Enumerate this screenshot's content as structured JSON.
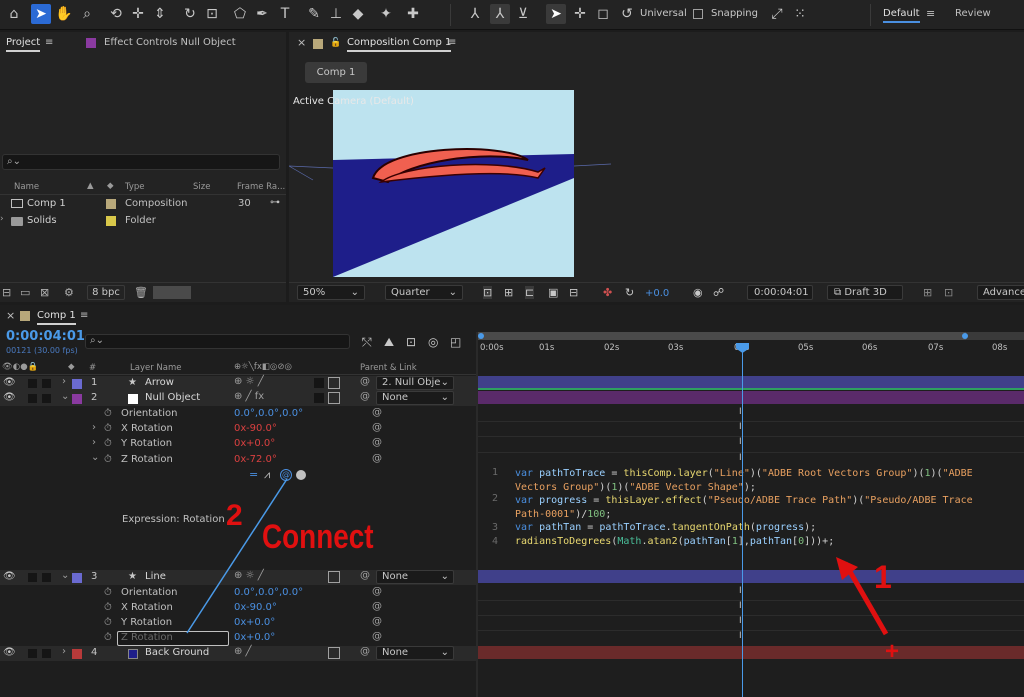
{
  "toolbar": {
    "tools": [
      "home-icon",
      "selection-tool-icon",
      "hand-tool-icon",
      "zoom-tool-icon",
      "orbit-tool-icon",
      "pan-tool-icon",
      "dolly-tool-icon",
      "rotation-tool-icon",
      "pan-behind-tool-icon",
      "shape-tool-icon",
      "pen-tool-icon",
      "type-tool-icon",
      "brush-tool-icon",
      "clone-stamp-icon",
      "eraser-icon",
      "roto-brush-icon",
      "puppet-pin-icon"
    ],
    "universal_label": "Universal",
    "snapping_label": "Snapping",
    "workspace_default": "Default",
    "workspace_review": "Review"
  },
  "project_panel": {
    "tab": "Project",
    "effect_controls_tab": "Effect Controls Null Object",
    "search_placeholder": "",
    "columns": {
      "name": "Name",
      "type": "Type",
      "size": "Size",
      "frame_rate": "Frame Ra..."
    },
    "items": [
      {
        "name": "Comp 1",
        "type": "Composition",
        "size": "",
        "frame_rate": "30",
        "label_color": "#b8a87a"
      },
      {
        "name": "Solids",
        "type": "Folder",
        "size": "",
        "frame_rate": "",
        "label_color": "#d8c84a"
      }
    ],
    "bpc": "8 bpc"
  },
  "composition_panel": {
    "tab": "Composition Comp 1",
    "comp_button": "Comp 1",
    "active_camera": "Active Camera (Default)",
    "zoom": "50%",
    "resolution": "Quarter",
    "exposure": "+0.0",
    "timecode": "0:00:04:01",
    "renderer": "Draft 3D",
    "advanced": "Advanced"
  },
  "timeline": {
    "tab": "Comp 1",
    "timecode": "0:00:04:01",
    "frame_info": "00121 (30.00 fps)",
    "columns": {
      "num": "#",
      "layer_name": "Layer Name",
      "parent": "Parent & Link"
    },
    "ruler": [
      "0:00s",
      "01s",
      "02s",
      "03s",
      "04s",
      "05s",
      "06s",
      "07s",
      "08s"
    ],
    "layers": [
      {
        "num": "1",
        "name": "Arrow",
        "parent": "2. Null Obje",
        "label_color": "#6a6ad0"
      },
      {
        "num": "2",
        "name": "Null Object",
        "parent": "None",
        "label_color": "#8a3aa0"
      },
      {
        "num": "3",
        "name": "Line",
        "parent": "None",
        "label_color": "#6a6ad0"
      },
      {
        "num": "4",
        "name": "Back Ground",
        "parent": "None",
        "label_color": "#b83a3a"
      }
    ],
    "props_null": [
      {
        "name": "Orientation",
        "value": "0.0°,0.0°,0.0°"
      },
      {
        "name": "X Rotation",
        "value_prefix": "0x",
        "value_suffix": "-90.0°"
      },
      {
        "name": "Y Rotation",
        "value_prefix": "0x",
        "value_suffix": "+0.0°"
      },
      {
        "name": "Z Rotation",
        "value_prefix": "0x",
        "value_suffix": "-72.0°"
      }
    ],
    "expression_label": "Expression: Rotation",
    "props_line": [
      {
        "name": "Orientation",
        "value": "0.0°,0.0°,0.0°"
      },
      {
        "name": "X Rotation",
        "value_prefix": "0x",
        "value_suffix": "-90.0°"
      },
      {
        "name": "Y Rotation",
        "value_prefix": "0x",
        "value_suffix": "+0.0°"
      },
      {
        "name": "Z Rotation",
        "value_prefix": "0x",
        "value_suffix": "+0.0°"
      }
    ],
    "code_line_numbers": [
      "1",
      "2",
      "3",
      "4"
    ],
    "annotations": {
      "step2_num": "2",
      "step2_text": "Connect",
      "step1_num": "1",
      "plus": "+"
    }
  },
  "colors": {
    "accent": "#2b6ad4",
    "annotation_red": "#e01010",
    "playhead": "#4a9ae8"
  }
}
